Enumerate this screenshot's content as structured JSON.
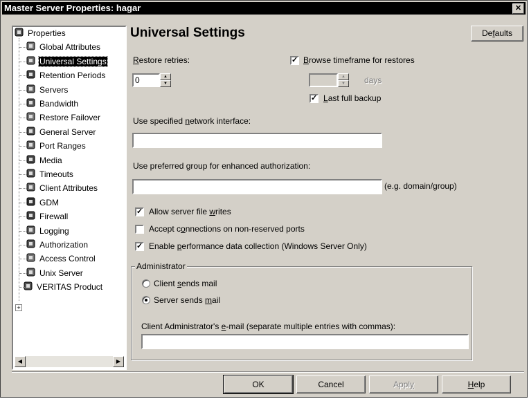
{
  "window": {
    "title": "Master Server Properties: hagar",
    "close_glyph": "✕"
  },
  "tree": {
    "items": [
      {
        "label": "Properties",
        "icon": "properties-icon",
        "selected": false
      },
      {
        "label": "Global Attributes",
        "icon": "global-attributes-icon",
        "selected": false
      },
      {
        "label": "Universal Settings",
        "icon": "universal-settings-icon",
        "selected": true
      },
      {
        "label": "Retention Periods",
        "icon": "retention-periods-icon",
        "selected": false
      },
      {
        "label": "Servers",
        "icon": "servers-icon",
        "selected": false
      },
      {
        "label": "Bandwidth",
        "icon": "bandwidth-icon",
        "selected": false
      },
      {
        "label": "Restore Failover",
        "icon": "restore-failover-icon",
        "selected": false
      },
      {
        "label": "General Server",
        "icon": "general-server-icon",
        "selected": false
      },
      {
        "label": "Port Ranges",
        "icon": "port-ranges-icon",
        "selected": false
      },
      {
        "label": "Media",
        "icon": "media-icon",
        "selected": false
      },
      {
        "label": "Timeouts",
        "icon": "timeouts-icon",
        "selected": false
      },
      {
        "label": "Client Attributes",
        "icon": "client-attributes-icon",
        "selected": false
      },
      {
        "label": "GDM",
        "icon": "gdm-icon",
        "selected": false
      },
      {
        "label": "Firewall",
        "icon": "firewall-icon",
        "selected": false
      },
      {
        "label": "Logging",
        "icon": "logging-icon",
        "selected": false
      },
      {
        "label": "Authorization",
        "icon": "authorization-icon",
        "selected": false
      },
      {
        "label": "Access Control",
        "icon": "access-control-icon",
        "selected": false
      },
      {
        "label": "Unix Server",
        "icon": "unix-server-icon",
        "selected": false
      },
      {
        "label": "VERITAS Product",
        "icon": "veritas-product-icon",
        "selected": false
      }
    ],
    "expander_glyph": "+",
    "scroll_left": "◀",
    "scroll_right": "▶"
  },
  "page": {
    "title": "Universal Settings",
    "defaults_button": {
      "pre": "De",
      "u": "f",
      "post": "aults"
    },
    "restore_retries": {
      "pre": "",
      "u": "R",
      "post": "estore retries:",
      "value": "0"
    },
    "browse_timeframe": {
      "checked": true,
      "check_glyph": "✓",
      "pre": "",
      "u": "B",
      "post": "rowse timeframe for restores",
      "days_value": "",
      "days_label": "days"
    },
    "last_full_backup": {
      "checked": true,
      "check_glyph": "✓",
      "pre": "",
      "u": "L",
      "post": "ast full backup"
    },
    "network_interface": {
      "pre": "Use specified ",
      "u": "n",
      "post": "etwork interface:",
      "value": ""
    },
    "preferred_group": {
      "pre": "Use preferred ",
      "u": "g",
      "post": "roup for enhanced authorization:",
      "value": "",
      "hint": "(e.g. domain/group)"
    },
    "allow_writes": {
      "checked": true,
      "check_glyph": "✓",
      "pre": "Allow server file ",
      "u": "w",
      "post": "rites"
    },
    "non_reserved": {
      "checked": false,
      "check_glyph": "",
      "pre": "Accept c",
      "u": "o",
      "post": "nnections on non-reserved ports"
    },
    "perf_collection": {
      "checked": true,
      "check_glyph": "✓",
      "pre": "Enable ",
      "u": "p",
      "post": "erformance data collection (Windows Server Only)"
    },
    "administrator": {
      "legend": "Administrator",
      "client_sends": {
        "selected": false,
        "pre": "Client ",
        "u": "s",
        "post": "ends mail"
      },
      "server_sends": {
        "selected": true,
        "pre": "Server sends ",
        "u": "m",
        "post": "ail"
      },
      "email": {
        "pre": "Client Administrator's ",
        "u": "e",
        "post": "-mail (separate multiple entries with commas):",
        "value": ""
      }
    }
  },
  "footer": {
    "ok": {
      "pre": "OK",
      "u": "",
      "post": ""
    },
    "cancel": {
      "pre": "Cancel",
      "u": "",
      "post": ""
    },
    "apply": {
      "pre": "Appl",
      "u": "y",
      "post": ""
    },
    "help": {
      "pre": "",
      "u": "H",
      "post": "elp"
    }
  }
}
